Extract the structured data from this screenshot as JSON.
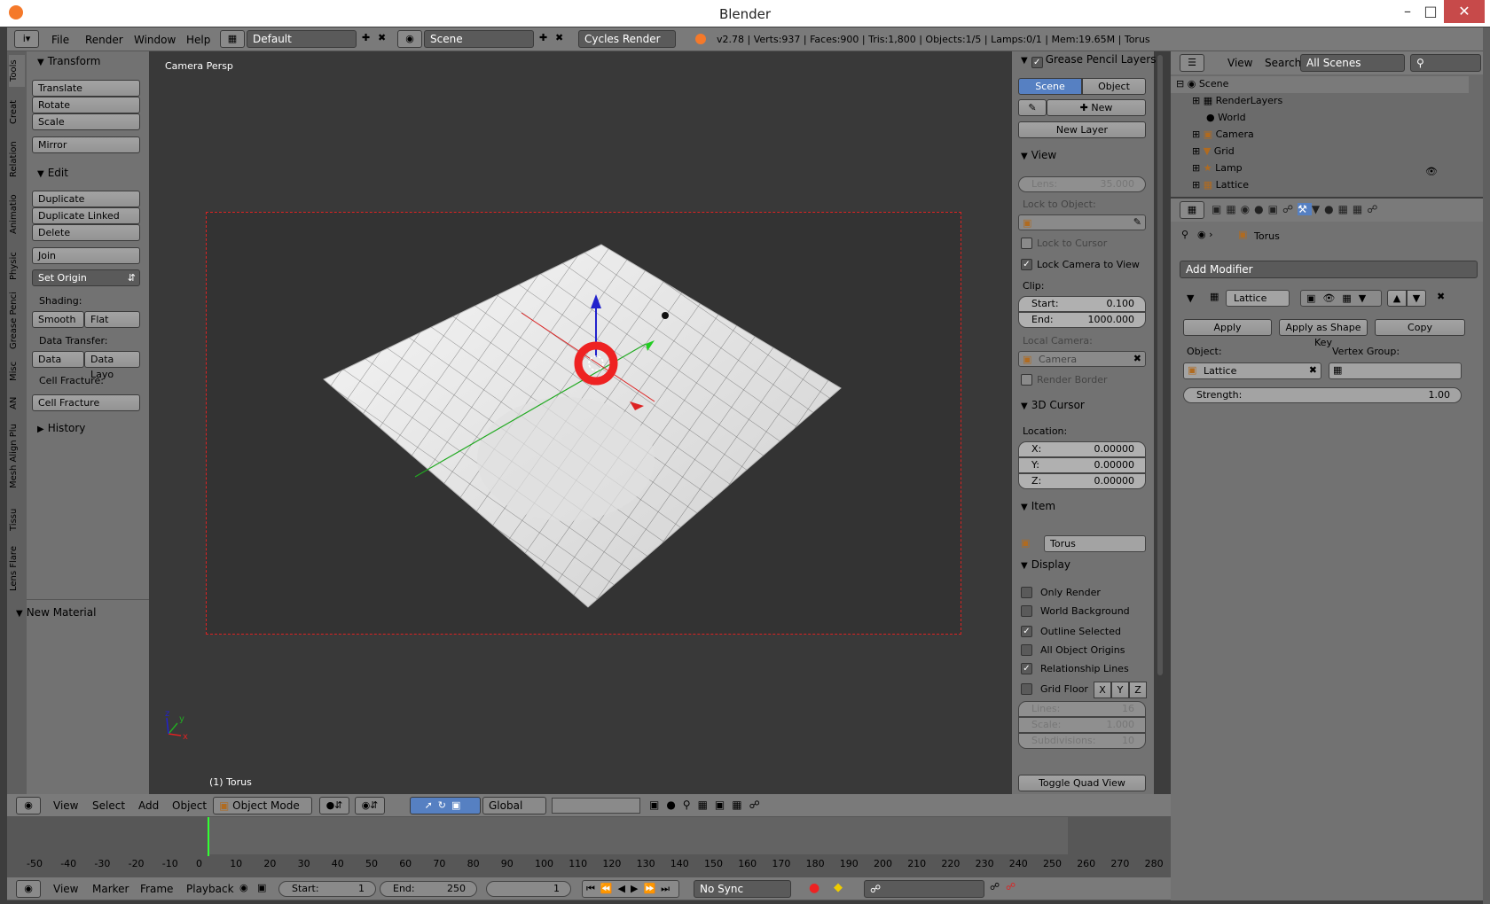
{
  "window": {
    "title": "Blender"
  },
  "info_header": {
    "menus": [
      "File",
      "Render",
      "Window",
      "Help"
    ],
    "layout": "Default",
    "scene": "Scene",
    "engine": "Cycles Render",
    "stats": "v2.78 | Verts:937 | Faces:900 | Tris:1,800 | Objects:1/5 | Lamps:0/1 | Mem:19.65M | Torus"
  },
  "tool_tabs": [
    "Tools",
    "Creat",
    "Relation",
    "Animatio",
    "Physic",
    "Grease Penci",
    "Misc",
    "AN",
    "Mesh Align Plu",
    "Tissu",
    "Lens Flare"
  ],
  "tools": {
    "transform_title": "Transform",
    "translate": "Translate",
    "rotate": "Rotate",
    "scale": "Scale",
    "mirror": "Mirror",
    "edit_title": "Edit",
    "duplicate": "Duplicate",
    "duplicate_linked": "Duplicate Linked",
    "delete": "Delete",
    "join": "Join",
    "set_origin": "Set Origin",
    "shading_label": "Shading:",
    "smooth": "Smooth",
    "flat": "Flat",
    "data_transfer_label": "Data Transfer:",
    "data": "Data",
    "data_layo": "Data Layo",
    "cell_fracture_label": "Cell Fracture:",
    "cell_fracture": "Cell Fracture",
    "history_title": "History",
    "new_material": "New Material"
  },
  "viewport": {
    "label": "Camera Persp",
    "object_label": "(1) Torus"
  },
  "npanel": {
    "grease_pencil_title": "Grease Pencil Layers",
    "scene_tab": "Scene",
    "object_tab": "Object",
    "new": "New",
    "new_layer": "New Layer",
    "view_title": "View",
    "lens_label": "Lens:",
    "lens_value": "35.000",
    "lock_to_object": "Lock to Object:",
    "lock_to_cursor": "Lock to Cursor",
    "lock_camera": "Lock Camera to View",
    "clip": "Clip:",
    "start_label": "Start:",
    "start_value": "0.100",
    "end_label": "End:",
    "end_value": "1000.000",
    "local_camera": "Local Camera:",
    "camera": "Camera",
    "render_border": "Render Border",
    "cursor_title": "3D Cursor",
    "location": "Location:",
    "x_label": "X:",
    "x_value": "0.00000",
    "y_label": "Y:",
    "y_value": "0.00000",
    "z_label": "Z:",
    "z_value": "0.00000",
    "item_title": "Item",
    "item_name": "Torus",
    "display_title": "Display",
    "only_render": "Only Render",
    "world_background": "World Background",
    "outline_selected": "Outline Selected",
    "all_object_origins": "All Object Origins",
    "relationship_lines": "Relationship Lines",
    "grid_floor": "Grid Floor",
    "axis_x": "X",
    "axis_y": "Y",
    "axis_z": "Z",
    "lines_label": "Lines:",
    "lines_value": "16",
    "scale_label": "Scale:",
    "scale_value": "1.000",
    "subdiv_label": "Subdivisions:",
    "subdiv_value": "10",
    "toggle_quad": "Toggle Quad View"
  },
  "outliner": {
    "view": "View",
    "search": "Search",
    "scenes": "All Scenes",
    "items": [
      "Scene",
      "RenderLayers",
      "World",
      "Camera",
      "Grid",
      "Lamp",
      "Lattice"
    ]
  },
  "properties": {
    "breadcrumb": "Torus",
    "add_modifier": "Add Modifier",
    "modifier_name": "Lattice",
    "apply": "Apply",
    "apply_shape": "Apply as Shape Key",
    "copy": "Copy",
    "object_label": "Object:",
    "object_value": "Lattice",
    "vertex_group_label": "Vertex Group:",
    "strength_label": "Strength:",
    "strength_value": "1.00"
  },
  "view3d_header": {
    "menus": [
      "View",
      "Select",
      "Add",
      "Object"
    ],
    "mode": "Object Mode",
    "orientation": "Global"
  },
  "timeline": {
    "ticks": [
      "-50",
      "-40",
      "-30",
      "-20",
      "-10",
      "0",
      "10",
      "20",
      "30",
      "40",
      "50",
      "60",
      "70",
      "80",
      "90",
      "100",
      "110",
      "120",
      "130",
      "140",
      "150",
      "160",
      "170",
      "180",
      "190",
      "200",
      "210",
      "220",
      "230",
      "240",
      "250",
      "260",
      "270",
      "280"
    ],
    "menus": [
      "View",
      "Marker",
      "Frame",
      "Playback"
    ],
    "start_label": "Start:",
    "start_value": "1",
    "end_label": "End:",
    "end_value": "250",
    "current": "1",
    "sync": "No Sync"
  },
  "colors": {
    "accent": "#5680c2",
    "selection": "#f5221d"
  }
}
